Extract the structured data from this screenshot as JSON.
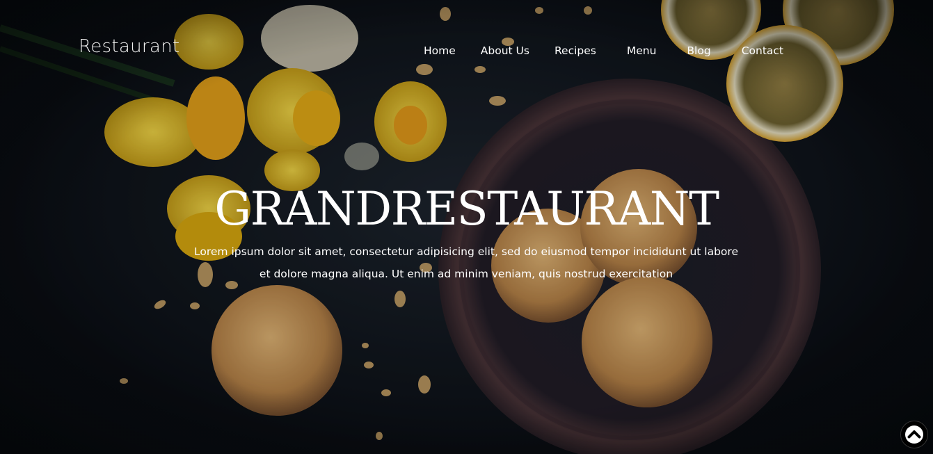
{
  "brand": {
    "logo_text": "Restaurant"
  },
  "nav": {
    "items": [
      {
        "label": "Home"
      },
      {
        "label": "About Us"
      },
      {
        "label": "Recipes"
      },
      {
        "label": "Menu"
      },
      {
        "label": "Blog"
      },
      {
        "label": "Contact"
      }
    ]
  },
  "hero": {
    "title": "GRANDRESTAURANT",
    "subtitle": "Lorem ipsum dolor sit amet, consectetur adipisicing elit, sed do eiusmod tempor incididunt ut labore et dolore magna aliqua. Ut enim ad minim veniam, quis nostrud exercitation"
  },
  "icons": {
    "scroll_top": "chevron-up-icon"
  },
  "colors": {
    "text": "#ffffff",
    "background": "#10151c",
    "flower_yellow": "#f2c81c",
    "cookie": "#c9995a",
    "bowl": "#3a2b33",
    "lemon": "#e8b23a"
  }
}
